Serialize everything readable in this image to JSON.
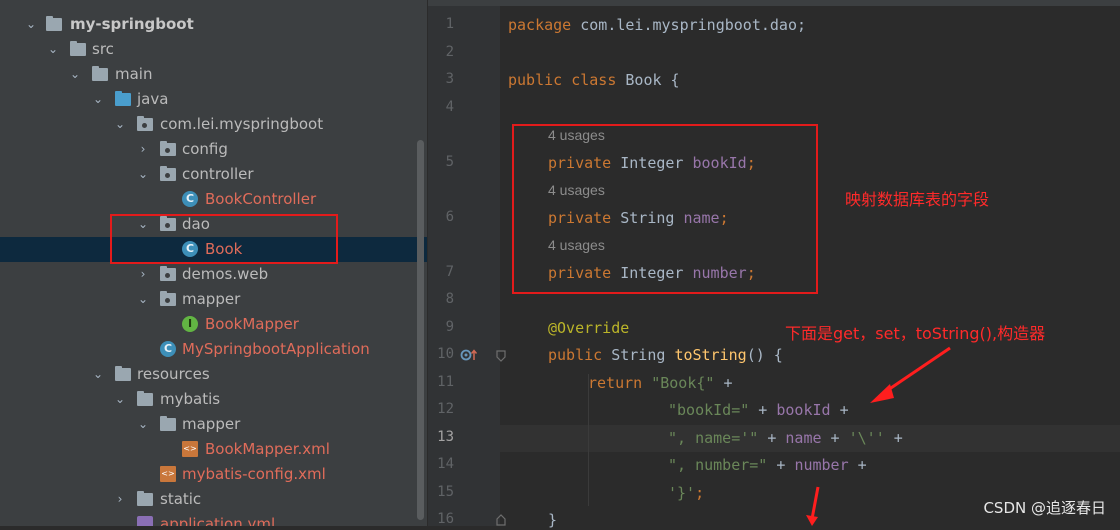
{
  "project_tree": {
    "root": "my-springboot",
    "items": [
      {
        "label": "src"
      },
      {
        "label": "main"
      },
      {
        "label": "java"
      },
      {
        "label": "com.lei.myspringboot"
      },
      {
        "label": "config"
      },
      {
        "label": "controller"
      },
      {
        "label": "BookController"
      },
      {
        "label": "dao"
      },
      {
        "label": "Book"
      },
      {
        "label": "demos.web"
      },
      {
        "label": "mapper"
      },
      {
        "label": "BookMapper"
      },
      {
        "label": "MySpringbootApplication"
      },
      {
        "label": "resources"
      },
      {
        "label": "mybatis"
      },
      {
        "label": "mapper"
      },
      {
        "label": "BookMapper.xml"
      },
      {
        "label": "mybatis-config.xml"
      },
      {
        "label": "static"
      },
      {
        "label": "application.yml"
      }
    ]
  },
  "editor": {
    "line_numbers": [
      "1",
      "2",
      "3",
      "4",
      "5",
      "6",
      "7",
      "8",
      "9",
      "10",
      "11",
      "12",
      "13",
      "14",
      "15",
      "16"
    ],
    "current_line": "13",
    "usages": [
      "4 usages",
      "4 usages",
      "4 usages"
    ],
    "code": {
      "l1_kw": "package",
      "l1_rest": " com.lei.myspringboot.dao;",
      "l3_kw": "public class",
      "l3_rest": " Book {",
      "l5_kw": "private",
      "l5_type": " Integer ",
      "l5_field": "bookId",
      "l5_end": ";",
      "l6_kw": "private",
      "l6_type": " String ",
      "l6_field": "name",
      "l6_end": ";",
      "l7_kw": "private",
      "l7_type": " Integer ",
      "l7_field": "number",
      "l7_end": ";",
      "l9_ann": "@Override",
      "l10_kw": "public",
      "l10_type": " String ",
      "l10_fn": "toString",
      "l10_end": "() {",
      "l11_kw": "return",
      "l11_str": " \"Book{\"",
      "l11_end": " +",
      "l12_str": "\"bookId=\"",
      "l12_op": " + ",
      "l12_field": "bookId",
      "l12_end": " +",
      "l13_str": "\", name='\"",
      "l13_op": " + ",
      "l13_field": "name",
      "l13_op2": " + ",
      "l13_str2": "'\\''",
      "l13_end": " +",
      "l14_str": "\", number=\"",
      "l14_op": " + ",
      "l14_field": "number",
      "l14_end": " +",
      "l15_str": "'}'",
      "l15_end": ";",
      "l16": "}"
    }
  },
  "annotations": {
    "fields_note": "映射数据库表的字段",
    "methods_note": "下面是get，set，toString(),构造器"
  },
  "watermark": "CSDN @追逐春日",
  "colors": {
    "keyword": "#cc7832",
    "field": "#9876aa",
    "string": "#6a8759",
    "method": "#ffc66d",
    "annotation": "#bbb529",
    "annotation_box": "#e31b1b"
  }
}
